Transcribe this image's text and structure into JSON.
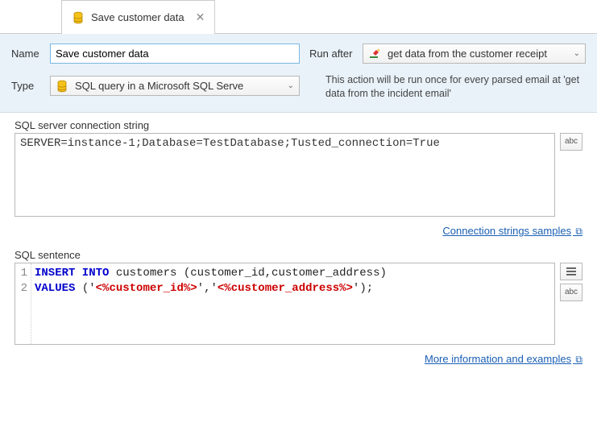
{
  "tab": {
    "title": "Save customer data"
  },
  "form": {
    "name_label": "Name",
    "name_value": "Save customer data",
    "type_label": "Type",
    "type_selected": "SQL query in a Microsoft SQL Serve",
    "run_after_label": "Run after",
    "run_after_selected": "get data from the customer receipt",
    "helper_text": "This action will be run once for every parsed email at 'get data from the incident email'"
  },
  "conn": {
    "label": "SQL server connection string",
    "value": "SERVER=instance-1;Database=TestDatabase;Tusted_connection=True",
    "abc_label": "abc",
    "link_text": "Connection strings samples"
  },
  "sql": {
    "label": "SQL sentence",
    "line1": {
      "num": "1",
      "kw": "INSERT INTO",
      "rest": " customers (customer_id,customer_address)"
    },
    "line2": {
      "num": "2",
      "kw": "VALUES",
      "open1": " ('",
      "v1": "<%customer_id%>",
      "mid": "','",
      "v2": "<%customer_address%>",
      "close": "');"
    },
    "abc_label": "abc",
    "link_text": "More information and examples"
  }
}
